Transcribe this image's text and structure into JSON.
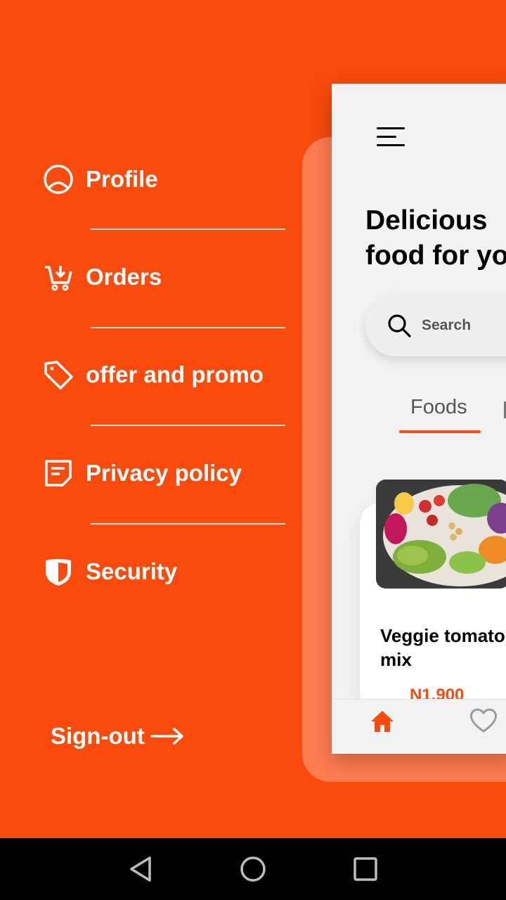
{
  "drawer": {
    "items": [
      {
        "label": "Profile",
        "icon": "profile-icon"
      },
      {
        "label": "Orders",
        "icon": "cart-icon"
      },
      {
        "label": "offer and promo",
        "icon": "tag-icon"
      },
      {
        "label": "Privacy policy",
        "icon": "document-icon"
      },
      {
        "label": "Security",
        "icon": "shield-icon"
      }
    ],
    "signout_label": "Sign-out"
  },
  "app": {
    "headline_line1": "Delicious",
    "headline_line2": "food for yo",
    "search_placeholder": "Search",
    "tabs": [
      {
        "label": "Foods",
        "active": true
      }
    ],
    "food_card": {
      "name_line1": "Veggie tomato",
      "name_line2": "mix",
      "price": "N1,900"
    }
  },
  "colors": {
    "accent": "#FA4A0C",
    "background": "#FA4A0C",
    "screen": "#F2F2F2"
  }
}
